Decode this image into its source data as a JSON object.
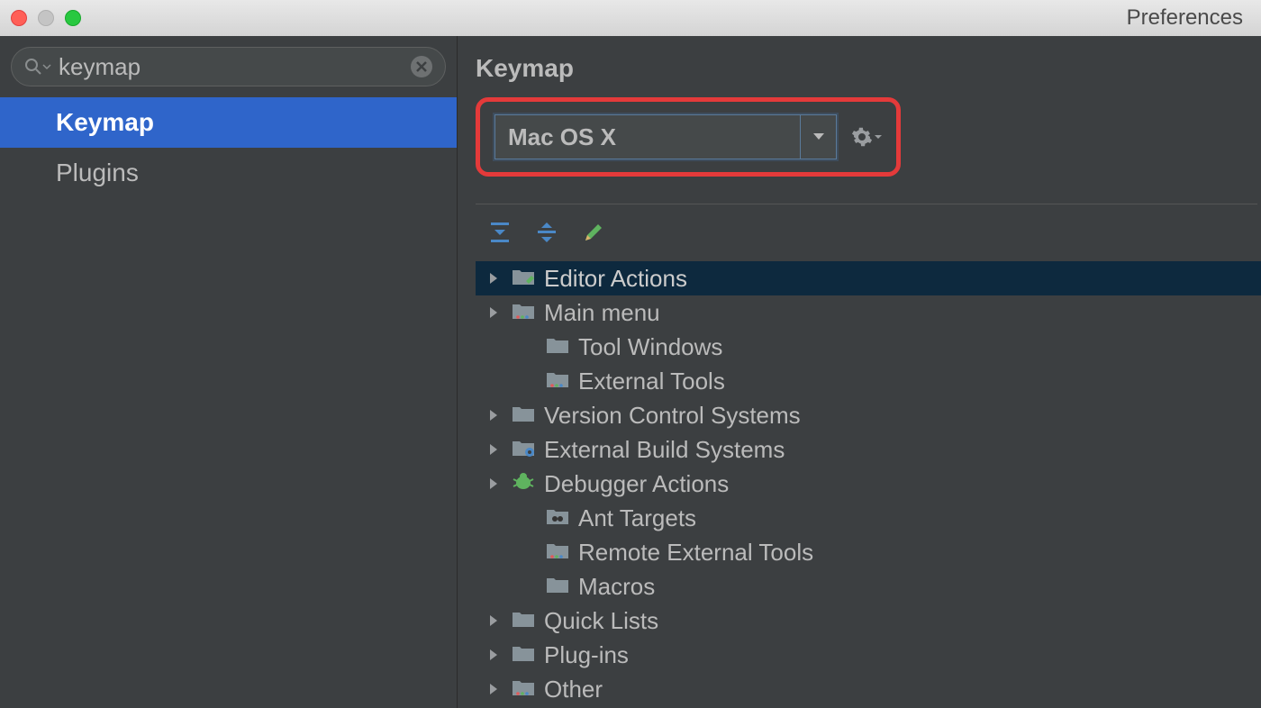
{
  "window": {
    "title": "Preferences"
  },
  "sidebar": {
    "search_value": "keymap",
    "items": [
      {
        "label": "Keymap",
        "selected": true
      },
      {
        "label": "Plugins",
        "selected": false
      }
    ]
  },
  "main": {
    "title": "Keymap",
    "dropdown_value": "Mac OS X",
    "tree": [
      {
        "label": "Editor Actions",
        "has_arrow": true,
        "icon": "folder-edit",
        "selected": true,
        "indent": 0
      },
      {
        "label": "Main menu",
        "has_arrow": true,
        "icon": "folder-dots",
        "selected": false,
        "indent": 0
      },
      {
        "label": "Tool Windows",
        "has_arrow": false,
        "icon": "folder",
        "selected": false,
        "indent": 1
      },
      {
        "label": "External Tools",
        "has_arrow": false,
        "icon": "folder-dots",
        "selected": false,
        "indent": 1
      },
      {
        "label": "Version Control Systems",
        "has_arrow": true,
        "icon": "folder",
        "selected": false,
        "indent": 0
      },
      {
        "label": "External Build Systems",
        "has_arrow": true,
        "icon": "folder-gear",
        "selected": false,
        "indent": 0
      },
      {
        "label": "Debugger Actions",
        "has_arrow": true,
        "icon": "bug",
        "selected": false,
        "indent": 0
      },
      {
        "label": "Ant Targets",
        "has_arrow": false,
        "icon": "folder-ant",
        "selected": false,
        "indent": 1
      },
      {
        "label": "Remote External Tools",
        "has_arrow": false,
        "icon": "folder-dots",
        "selected": false,
        "indent": 1
      },
      {
        "label": "Macros",
        "has_arrow": false,
        "icon": "folder",
        "selected": false,
        "indent": 1
      },
      {
        "label": "Quick Lists",
        "has_arrow": true,
        "icon": "folder",
        "selected": false,
        "indent": 0
      },
      {
        "label": "Plug-ins",
        "has_arrow": true,
        "icon": "folder",
        "selected": false,
        "indent": 0
      },
      {
        "label": "Other",
        "has_arrow": true,
        "icon": "folder-dots",
        "selected": false,
        "indent": 0
      }
    ]
  }
}
